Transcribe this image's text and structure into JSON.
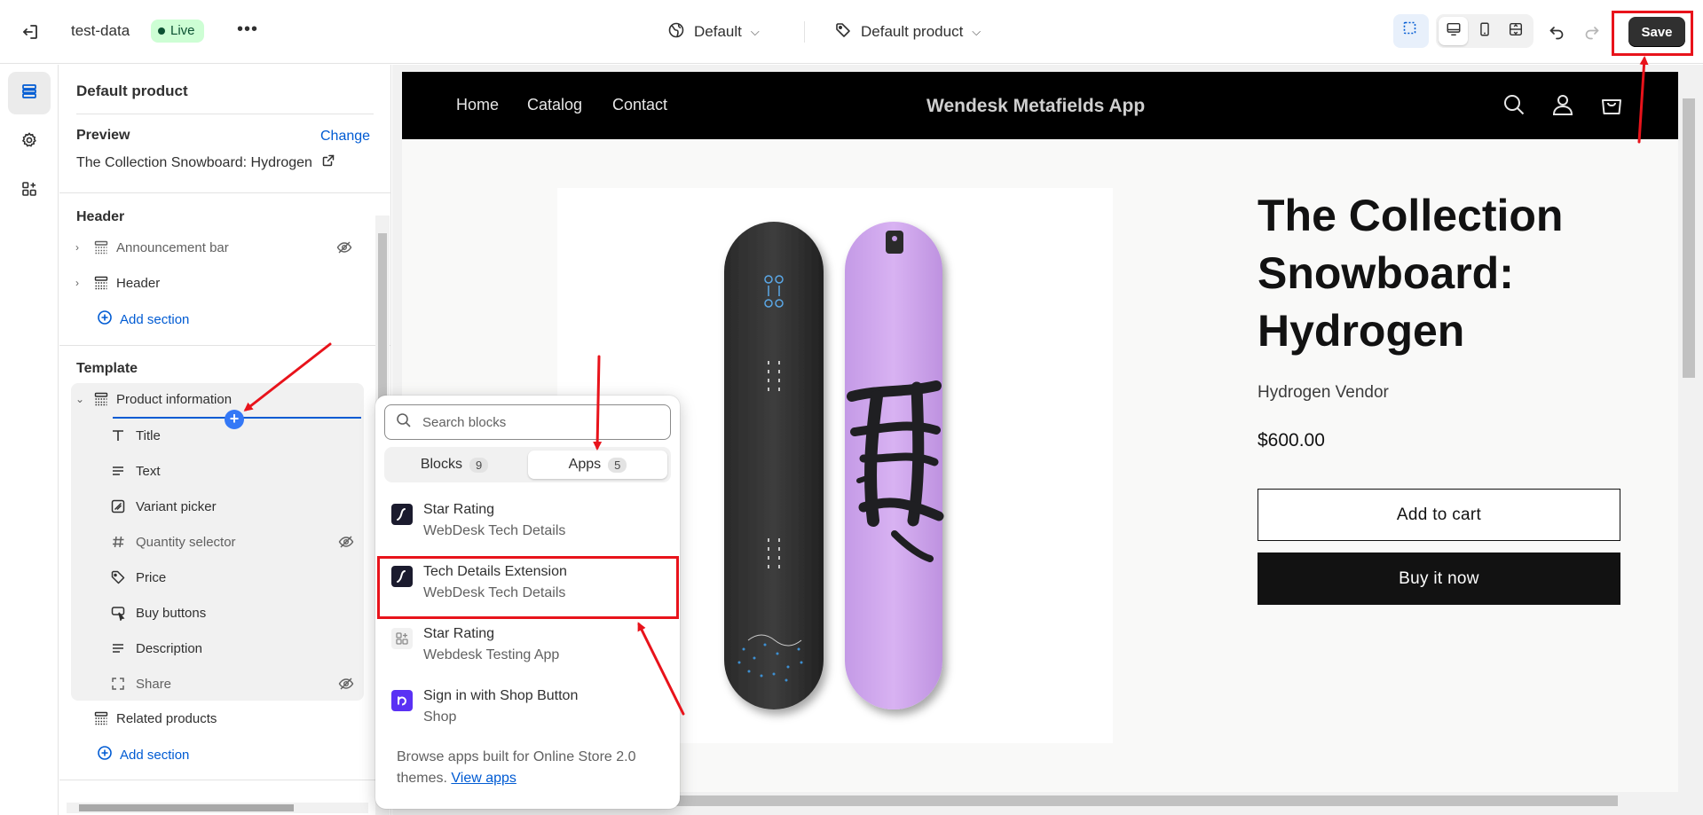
{
  "topbar": {
    "store_name": "test-data",
    "live_label": "Live",
    "more_label": "•••",
    "theme_label": "Default",
    "template_label": "Default product",
    "save_label": "Save"
  },
  "sidebar": {
    "title": "Default product",
    "preview_label": "Preview",
    "change_label": "Change",
    "preview_value": "The Collection Snowboard: Hydrogen",
    "header_heading": "Header",
    "header_items": [
      "Announcement bar",
      "Header"
    ],
    "add_section_label": "Add section",
    "template_heading": "Template",
    "section_label": "Product information",
    "blocks": [
      "Title",
      "Text",
      "Variant picker",
      "Quantity selector",
      "Price",
      "Buy buttons",
      "Description",
      "Share"
    ],
    "related_label": "Related products"
  },
  "store": {
    "nav": [
      "Home",
      "Catalog",
      "Contact"
    ],
    "brand": "Wendesk Metafields App",
    "product_title": "The Collection Snowboard: Hydrogen",
    "vendor": "Hydrogen Vendor",
    "price": "$600.00",
    "add_to_cart": "Add to cart",
    "buy_now": "Buy it now"
  },
  "picker": {
    "search_placeholder": "Search blocks",
    "tabs": [
      {
        "label": "Blocks",
        "count": "9"
      },
      {
        "label": "Apps",
        "count": "5"
      }
    ],
    "apps": [
      {
        "name": "Star Rating",
        "provider": "WebDesk Tech Details"
      },
      {
        "name": "Tech Details Extension",
        "provider": "WebDesk Tech Details"
      },
      {
        "name": "Star Rating",
        "provider": "Webdesk Testing App"
      },
      {
        "name": "Sign in with Shop Button",
        "provider": "Shop"
      }
    ],
    "footer_text": "Browse apps built for Online Store 2.0 themes.",
    "footer_link": "View apps"
  },
  "colors": {
    "accent_blue": "#005bd3",
    "annotation_red": "#e8131b",
    "live_green": "#cdfed4",
    "shop_purple": "#5a31f4"
  }
}
